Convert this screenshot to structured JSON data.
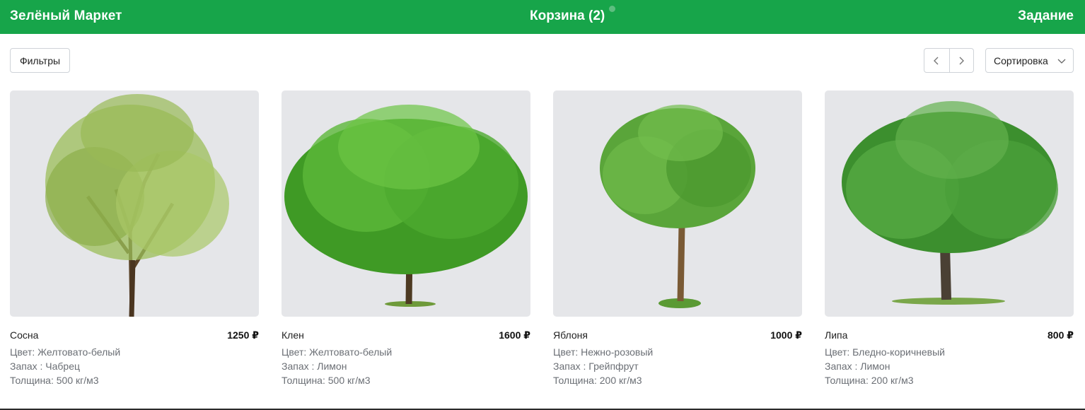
{
  "header": {
    "brand": "Зелёный Маркет",
    "cart_label": "Корзина (2)",
    "task_label": "Задание",
    "bg_color": "#17a54a"
  },
  "toolbar": {
    "filters_label": "Фильтры",
    "sort_label": "Сортировка",
    "prev_icon": "chevron-left-icon",
    "next_icon": "chevron-right-icon"
  },
  "products": [
    {
      "name": "Сосна",
      "price": "1250 ₽",
      "color": "Цвет: Желтовато-белый",
      "smell": "Запах : Чабрец",
      "thickness": "Толщина: 500 кг/м3",
      "image": "tree-photo"
    },
    {
      "name": "Клен",
      "price": "1600 ₽",
      "color": "Цвет: Желтовато-белый",
      "smell": "Запах : Лимон",
      "thickness": "Толщина: 500 кг/м3",
      "image": "tree-photo"
    },
    {
      "name": "Яблоня",
      "price": "1000 ₽",
      "color": "Цвет: Нежно-розовый",
      "smell": "Запах : Грейпфрут",
      "thickness": "Толщина: 200 кг/м3",
      "image": "tree-photo"
    },
    {
      "name": "Липа",
      "price": "800 ₽",
      "color": "Цвет: Бледно-коричневый",
      "smell": "Запах : Лимон",
      "thickness": "Толщина: 200 кг/м3",
      "image": "tree-photo"
    }
  ]
}
